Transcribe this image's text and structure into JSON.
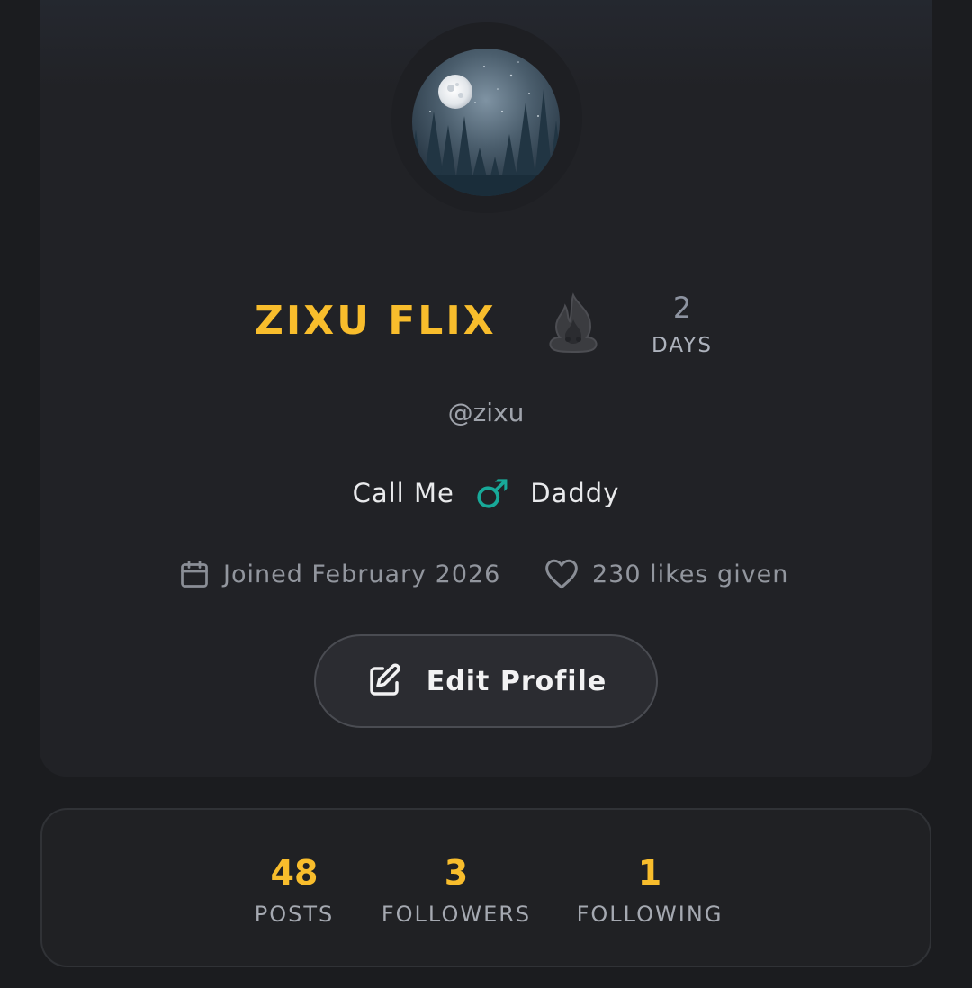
{
  "profile": {
    "display_name": "ZIXU FLIX",
    "username": "@zixu",
    "avatar_icon": "moon-forest-avatar",
    "streak": {
      "icon": "fire-streak-icon",
      "count": "2",
      "unit": "DAYS"
    },
    "bio": {
      "before": "Call Me",
      "symbol": "♂",
      "after": "Daddy"
    },
    "joined": "Joined February 2026",
    "likes_given": "230 likes given",
    "edit_label": "Edit Profile"
  },
  "stats": [
    {
      "value": "48",
      "label": "POSTS"
    },
    {
      "value": "3",
      "label": "FOLLOWERS"
    },
    {
      "value": "1",
      "label": "FOLLOWING"
    }
  ],
  "colors": {
    "accent": "#f8bd2c",
    "male_symbol": "#18a999",
    "background": "#1b1c1f",
    "card": "#212226"
  }
}
